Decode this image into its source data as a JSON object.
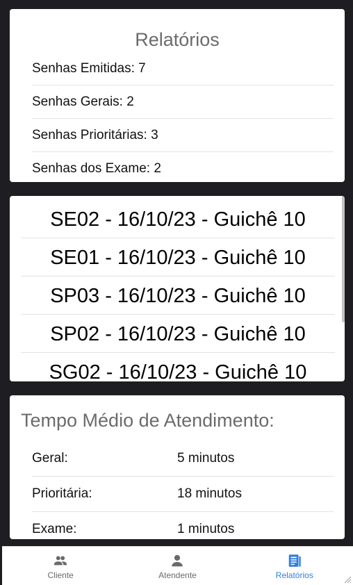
{
  "relatorios": {
    "title": "Relatórios",
    "items": [
      "Senhas Emitidas: 7",
      "Senhas Gerais: 2",
      "Senhas Prioritárias: 3",
      "Senhas dos Exame: 2"
    ]
  },
  "senhas": {
    "items": [
      "SE02 - 16/10/23 - Guichê 10",
      "SE01 - 16/10/23 - Guichê 10",
      "SP03 - 16/10/23 - Guichê 10",
      "SP02 - 16/10/23 - Guichê 10",
      "SG02 - 16/10/23 - Guichê 10"
    ]
  },
  "tempo_medio": {
    "title": "Tempo Médio de Atendimento:",
    "rows": [
      {
        "label": "Geral:",
        "value": "5 minutos"
      },
      {
        "label": "Prioritária:",
        "value": "18 minutos"
      },
      {
        "label": "Exame:",
        "value": "1 minutos"
      }
    ]
  },
  "nav": {
    "tabs": [
      {
        "label": "Cliente",
        "icon": "people-icon"
      },
      {
        "label": "Atendente",
        "icon": "person-icon"
      },
      {
        "label": "Relatórios",
        "icon": "report-icon"
      }
    ],
    "active_tab": "Relatórios",
    "accent_color": "#2f7de1"
  }
}
